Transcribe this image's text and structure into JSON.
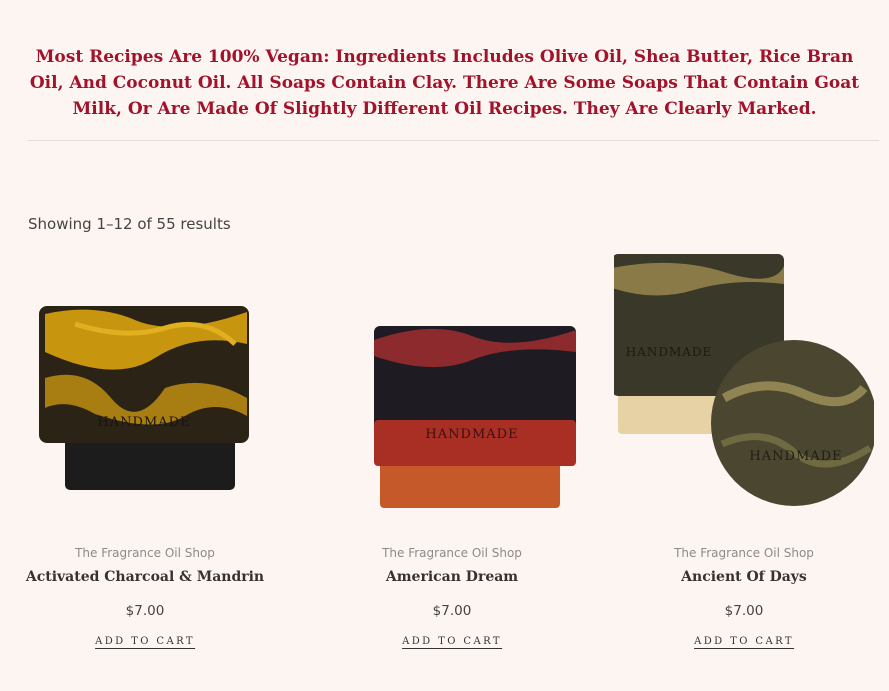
{
  "notice": {
    "text": "Most Recipes Are 100% Vegan: Ingredients Includes Olive Oil, Shea Butter, Rice Bran Oil, And Coconut Oil. All Soaps Contain Clay. There Are Some Soaps That Contain Goat Milk, Or Are Made Of Slightly Different Oil Recipes. They Are Clearly Marked."
  },
  "results": {
    "count_text": "Showing 1–12 of 55 results"
  },
  "colors": {
    "background": "#fdf5f1",
    "notice_text": "#a2122a",
    "product_name": "#3b3030"
  },
  "products": [
    {
      "vendor": "The Fragrance Oil Shop",
      "name": "Activated Charcoal & Mandrin",
      "price": "$7.00",
      "cta": "ADD TO CART",
      "image_alt": "black and orange swirled soap bar stamped HANDMADE"
    },
    {
      "vendor": "The Fragrance Oil Shop",
      "name": "American Dream",
      "price": "$7.00",
      "cta": "ADD TO CART",
      "image_alt": "black, red and orange layered soap bar stamped HANDMADE"
    },
    {
      "vendor": "The Fragrance Oil Shop",
      "name": "Ancient Of Days",
      "price": "$7.00",
      "cta": "ADD TO CART",
      "image_alt": "dark olive soap bar and round soap puck stamped HANDMADE"
    }
  ]
}
